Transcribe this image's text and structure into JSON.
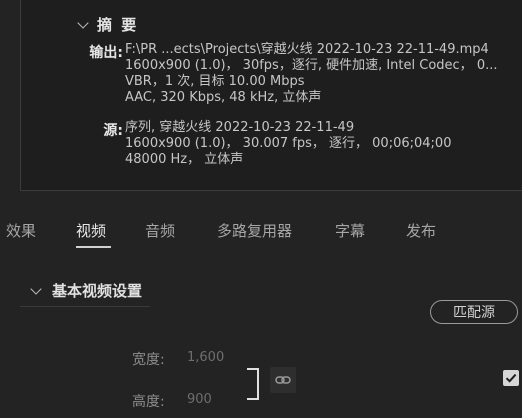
{
  "summary": {
    "title": "摘 要",
    "output_label": "输出:",
    "output_lines": [
      "F:\\PR   ...ects\\Projects\\穿越火线 2022-10-23 22-11-49.mp4",
      "1600x900 (1.0)， 30fps，逐行, 硬件加速, Intel Codec， 0...",
      "VBR，1 次, 目标 10.00 Mbps",
      "AAC, 320 Kbps, 48  kHz, 立体声"
    ],
    "source_label": "源:",
    "source_lines": [
      "序列, 穿越火线 2022-10-23 22-11-49",
      "1600x900 (1.0)， 30.007 fps， 逐行， 00;06;04;00",
      "48000 Hz， 立体声"
    ]
  },
  "tabs": [
    "效果",
    "视频",
    "音频",
    "多路复用器",
    "字幕",
    "发布"
  ],
  "active_tab": "视频",
  "video_section": {
    "title": "基本视频设置",
    "match_source_button": "匹配源",
    "width_label": "宽度:",
    "width_value": "1,600",
    "height_label": "高度:",
    "height_value": "900",
    "lock_checked": true
  }
}
